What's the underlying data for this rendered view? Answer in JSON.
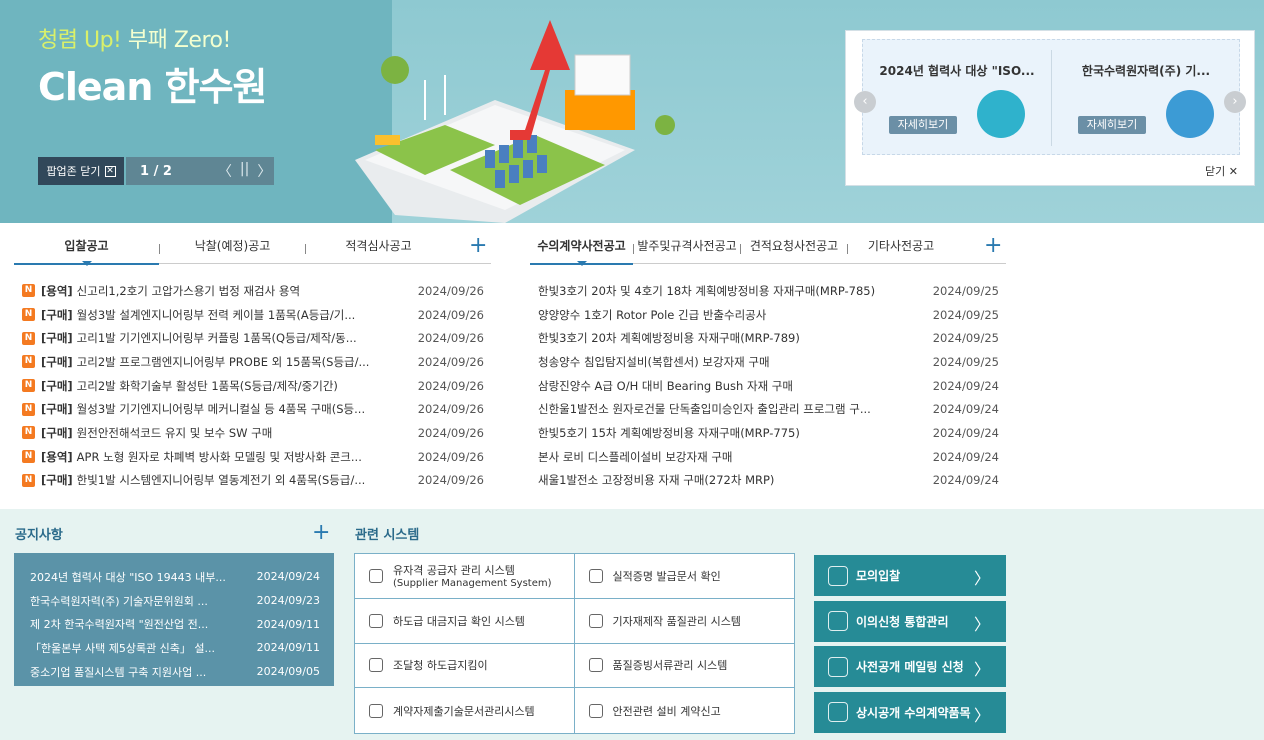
{
  "hero": {
    "slogan_a": "청렴 Up!",
    "slogan_b": "부패 Zero!",
    "title": "Clean 한수원",
    "popup_close_label": "팝업존 닫기",
    "pager": "1 / 2",
    "pager_prev": "〈",
    "pager_pause": "||",
    "pager_next": "〉"
  },
  "popup_panel": {
    "cards": [
      {
        "title": "2024년 협력사 대상 \"ISO...",
        "more_label": "자세히보기",
        "icon": "monitor-chart-icon"
      },
      {
        "title": "한국수력원자력(주) 기...",
        "more_label": "자세히보기",
        "icon": "growth-chart-icon"
      }
    ],
    "close_label": "닫기"
  },
  "bid_tabs": {
    "tabs": [
      "입찰공고",
      "낙찰(예정)공고",
      "적격심사공고"
    ],
    "more": "+",
    "items": [
      {
        "cat": "[용역]",
        "title": "신고리1,2호기 고압가스용기 법정 재검사 용역",
        "date": "2024/09/26"
      },
      {
        "cat": "[구매]",
        "title": "월성3발 설계엔지니어링부 전력 케이블 1품목(A등급/기...",
        "date": "2024/09/26"
      },
      {
        "cat": "[구매]",
        "title": "고리1발 기기엔지니어링부 커플링 1품목(Q등급/제작/동...",
        "date": "2024/09/26"
      },
      {
        "cat": "[구매]",
        "title": "고리2발 프로그램엔지니어링부 PROBE 외 15품목(S등급/...",
        "date": "2024/09/26"
      },
      {
        "cat": "[구매]",
        "title": "고리2발 화학기술부 활성탄 1품목(S등급/제작/중기간)",
        "date": "2024/09/26"
      },
      {
        "cat": "[구매]",
        "title": "월성3발 기기엔지니어링부 메커니컬실 등 4품목 구매(S등...",
        "date": "2024/09/26"
      },
      {
        "cat": "[구매]",
        "title": "원전안전해석코드 유지 및 보수 SW 구매",
        "date": "2024/09/26"
      },
      {
        "cat": "[용역]",
        "title": "APR 노형 원자로 차폐벽 방사화 모델링 및 저방사화 콘크...",
        "date": "2024/09/26"
      },
      {
        "cat": "[구매]",
        "title": "한빛1발 시스템엔지니어링부 열동계전기 외 4품목(S등급/...",
        "date": "2024/09/26"
      }
    ],
    "new_badge": "N"
  },
  "pre_tabs": {
    "tabs": [
      "수의계약사전공고",
      "발주및규격사전공고",
      "견적요청사전공고",
      "기타사전공고"
    ],
    "more": "+",
    "items": [
      {
        "title": "한빛3호기 20차 및 4호기 18차 계획예방정비용 자재구매(MRP-785)",
        "date": "2024/09/25"
      },
      {
        "title": "양양양수 1호기 Rotor Pole 긴급 반출수리공사",
        "date": "2024/09/25"
      },
      {
        "title": "한빛3호기 20차 계획예방정비용 자재구매(MRP-789)",
        "date": "2024/09/25"
      },
      {
        "title": "청송양수 침입탐지설비(복합센서) 보강자재 구매",
        "date": "2024/09/25"
      },
      {
        "title": "삼랑진양수 A급 O/H 대비 Bearing Bush 자재 구매",
        "date": "2024/09/24"
      },
      {
        "title": "신한울1발전소 원자로건물 단독출입미승인자 출입관리 프로그램 구...",
        "date": "2024/09/24"
      },
      {
        "title": "한빛5호기 15차 계획예방정비용 자재구매(MRP-775)",
        "date": "2024/09/24"
      },
      {
        "title": "본사 로비 디스플레이설비 보강자재 구매",
        "date": "2024/09/24"
      },
      {
        "title": "새울1발전소 고장정비용 자재 구매(272차 MRP)",
        "date": "2024/09/24"
      }
    ]
  },
  "notice": {
    "title": "공지사항",
    "more": "+",
    "items": [
      {
        "title": "2024년 협력사 대상 \"ISO 19443 내부...",
        "date": "2024/09/24"
      },
      {
        "title": "한국수력원자력(주) 기술자문위원회 ...",
        "date": "2024/09/23"
      },
      {
        "title": "제 2차 한국수력원자력 \"원전산업 전...",
        "date": "2024/09/11"
      },
      {
        "title": "「한울본부 사택 제5상록관 신축」 설...",
        "date": "2024/09/11"
      },
      {
        "title": "중소기업 품질시스템 구축 지원사업 ...",
        "date": "2024/09/05"
      }
    ]
  },
  "related": {
    "title": "관련 시스템",
    "items": [
      {
        "label": "유자격 공급자 관리 시스템",
        "sub": "(Supplier Management System)",
        "icon": "globe-icon"
      },
      {
        "label": "실적증명 발급문서 확인",
        "sub": "",
        "icon": "document-icon"
      },
      {
        "label": "하도급 대금지급 확인 시스템",
        "sub": "",
        "icon": "coins-icon"
      },
      {
        "label": "기자재제작 품질관리 시스템",
        "sub": "",
        "icon": "gear-icon"
      },
      {
        "label": "조달청 하도급지킴이",
        "sub": "",
        "icon": "shield-icon"
      },
      {
        "label": "품질증빙서류관리 시스템",
        "sub": "",
        "icon": "document-icon"
      },
      {
        "label": "계약자제출기술문서관리시스템",
        "sub": "",
        "icon": "clipboard-icon"
      },
      {
        "label": "안전관련 설비 계약신고",
        "sub": "",
        "icon": "atom-icon"
      }
    ]
  },
  "quick": [
    {
      "label": "모의입찰",
      "icon": "hand-pointer-icon"
    },
    {
      "label": "이의신청 통합관리",
      "icon": "users-icon"
    },
    {
      "label": "사전공개 메일링 신청",
      "icon": "handshake-icon"
    },
    {
      "label": "상시공개 수의계약품목",
      "icon": "users-icon"
    }
  ],
  "colors": {
    "accent": "#2a7ab0",
    "new_badge": "#f47a21",
    "quick_bg": "#268b96",
    "notice_bg": "#5b93a8"
  }
}
